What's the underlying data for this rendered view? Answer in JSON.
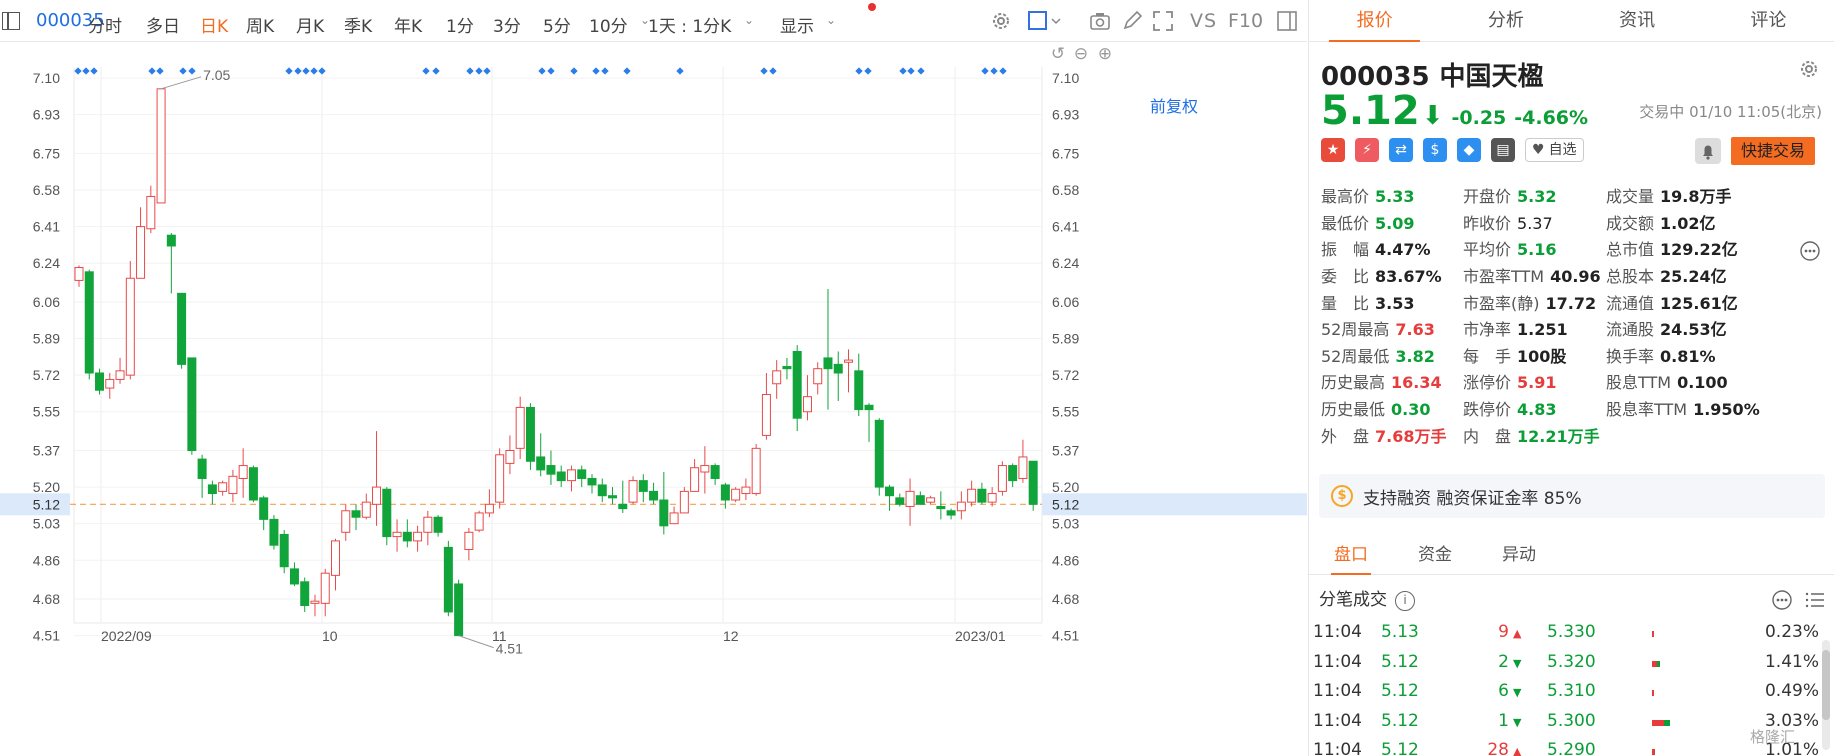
{
  "toolbar": {
    "code": "000035",
    "periods": [
      {
        "label": "分时",
        "left": 0
      },
      {
        "label": "多日"
      },
      {
        "label": "日K",
        "active": true
      },
      {
        "label": "周K"
      },
      {
        "label": "月K"
      },
      {
        "label": "季K"
      },
      {
        "label": "年K"
      },
      {
        "label": "1分"
      },
      {
        "label": "3分"
      },
      {
        "label": "5分"
      },
      {
        "label": "10分"
      },
      {
        "label": "1天 : 1分K"
      },
      {
        "label": "显示"
      }
    ],
    "vs_label": "VS",
    "f10_label": "F10",
    "fq_label": "前复权"
  },
  "chart_data": {
    "type": "candlestick",
    "y_ticks": [
      "7.10",
      "6.93",
      "6.75",
      "6.58",
      "6.41",
      "6.24",
      "6.06",
      "5.89",
      "5.72",
      "5.55",
      "5.37",
      "5.20",
      "5.03",
      "4.86",
      "4.68",
      "4.51"
    ],
    "x_labels": [
      "2022/09",
      "10",
      "11",
      "12",
      "2023/01"
    ],
    "ylim": [
      4.42,
      7.17
    ],
    "current_price": "5.12",
    "max_label": "7.05",
    "min_label": "4.51",
    "candles": [
      [
        6.16,
        6.22,
        6.13,
        6.23
      ],
      [
        6.2,
        5.73,
        5.7,
        6.21
      ],
      [
        5.73,
        5.65,
        5.63,
        5.75
      ],
      [
        5.66,
        5.7,
        5.61,
        5.73
      ],
      [
        5.7,
        5.74,
        5.68,
        5.8
      ],
      [
        5.72,
        6.17,
        5.7,
        6.25
      ],
      [
        6.17,
        6.41,
        6.28,
        6.5
      ],
      [
        6.4,
        6.55,
        6.38,
        6.6
      ],
      [
        6.52,
        7.05,
        6.52,
        7.05
      ],
      [
        6.37,
        6.32,
        6.1,
        6.38
      ],
      [
        6.1,
        5.77,
        5.75,
        6.1
      ],
      [
        5.8,
        5.37,
        5.35,
        5.8
      ],
      [
        5.33,
        5.24,
        5.15,
        5.35
      ],
      [
        5.21,
        5.17,
        5.12,
        5.23
      ],
      [
        5.18,
        5.22,
        5.16,
        5.23
      ],
      [
        5.17,
        5.25,
        5.13,
        5.28
      ],
      [
        5.24,
        5.3,
        5.15,
        5.38
      ],
      [
        5.29,
        5.14,
        5.13,
        5.3
      ],
      [
        5.15,
        5.05,
        5.0,
        5.16
      ],
      [
        5.05,
        4.93,
        4.91,
        5.07
      ],
      [
        4.98,
        4.83,
        4.8,
        5.0
      ],
      [
        4.82,
        4.75,
        4.74,
        4.85
      ],
      [
        4.76,
        4.65,
        4.62,
        4.78
      ],
      [
        4.66,
        4.67,
        4.6,
        4.7
      ],
      [
        4.66,
        4.8,
        4.6,
        4.82
      ],
      [
        4.79,
        4.95,
        4.72,
        4.96
      ],
      [
        4.99,
        5.09,
        4.95,
        5.12
      ],
      [
        5.09,
        5.06,
        5.0,
        5.12
      ],
      [
        5.06,
        5.13,
        5.05,
        5.17
      ],
      [
        5.12,
        5.2,
        5.02,
        5.46
      ],
      [
        5.19,
        4.97,
        4.93,
        5.2
      ],
      [
        4.97,
        4.99,
        4.9,
        5.05
      ],
      [
        4.99,
        4.95,
        4.92,
        5.05
      ],
      [
        4.95,
        4.99,
        4.9,
        5.02
      ],
      [
        4.99,
        5.06,
        4.93,
        5.09
      ],
      [
        5.06,
        4.99,
        4.97,
        5.07
      ],
      [
        4.92,
        4.62,
        4.6,
        4.95
      ],
      [
        4.75,
        4.51,
        4.51,
        4.77
      ],
      [
        4.91,
        4.99,
        4.86,
        5.01
      ],
      [
        5.0,
        5.08,
        4.99,
        5.09
      ],
      [
        5.08,
        5.12,
        5.06,
        5.19
      ],
      [
        5.13,
        5.35,
        5.1,
        5.38
      ],
      [
        5.31,
        5.37,
        5.26,
        5.44
      ],
      [
        5.38,
        5.57,
        5.33,
        5.62
      ],
      [
        5.57,
        5.32,
        5.28,
        5.59
      ],
      [
        5.34,
        5.28,
        5.25,
        5.45
      ],
      [
        5.3,
        5.26,
        5.21,
        5.37
      ],
      [
        5.27,
        5.23,
        5.2,
        5.3
      ],
      [
        5.23,
        5.28,
        5.18,
        5.3
      ],
      [
        5.28,
        5.24,
        5.2,
        5.3
      ],
      [
        5.24,
        5.21,
        5.17,
        5.26
      ],
      [
        5.21,
        5.16,
        5.13,
        5.24
      ],
      [
        5.16,
        5.15,
        5.12,
        5.2
      ],
      [
        5.12,
        5.1,
        5.08,
        5.23
      ],
      [
        5.13,
        5.23,
        5.12,
        5.25
      ],
      [
        5.23,
        5.18,
        5.13,
        5.26
      ],
      [
        5.18,
        5.14,
        5.12,
        5.22
      ],
      [
        5.14,
        5.02,
        4.98,
        5.27
      ],
      [
        5.03,
        5.08,
        5.03,
        5.11
      ],
      [
        5.08,
        5.18,
        5.08,
        5.2
      ],
      [
        5.18,
        5.29,
        5.18,
        5.33
      ],
      [
        5.27,
        5.3,
        5.17,
        5.39
      ],
      [
        5.3,
        5.24,
        5.21,
        5.31
      ],
      [
        5.21,
        5.14,
        5.1,
        5.22
      ],
      [
        5.14,
        5.19,
        5.13,
        5.2
      ],
      [
        5.17,
        5.2,
        5.14,
        5.24
      ],
      [
        5.17,
        5.38,
        5.16,
        5.4
      ],
      [
        5.44,
        5.63,
        5.42,
        5.73
      ],
      [
        5.68,
        5.74,
        5.61,
        5.79
      ],
      [
        5.76,
        5.75,
        5.7,
        5.8
      ],
      [
        5.83,
        5.52,
        5.46,
        5.86
      ],
      [
        5.55,
        5.62,
        5.51,
        5.72
      ],
      [
        5.68,
        5.75,
        5.63,
        5.78
      ],
      [
        5.8,
        5.75,
        5.56,
        6.12
      ],
      [
        5.77,
        5.73,
        5.6,
        5.83
      ],
      [
        5.78,
        5.79,
        5.64,
        5.84
      ],
      [
        5.74,
        5.56,
        5.53,
        5.82
      ],
      [
        5.58,
        5.56,
        5.41,
        5.59
      ],
      [
        5.51,
        5.2,
        5.16,
        5.52
      ],
      [
        5.2,
        5.16,
        5.09,
        5.21
      ],
      [
        5.15,
        5.12,
        5.11,
        5.17
      ],
      [
        5.11,
        5.18,
        5.02,
        5.24
      ],
      [
        5.16,
        5.12,
        5.12,
        5.18
      ],
      [
        5.13,
        5.15,
        5.12,
        5.16
      ],
      [
        5.11,
        5.1,
        5.05,
        5.18
      ],
      [
        5.09,
        5.07,
        5.05,
        5.1
      ],
      [
        5.09,
        5.13,
        5.05,
        5.18
      ],
      [
        5.13,
        5.19,
        5.11,
        5.23
      ],
      [
        5.19,
        5.13,
        5.12,
        5.22
      ],
      [
        5.13,
        5.17,
        5.11,
        5.2
      ],
      [
        5.18,
        5.3,
        5.16,
        5.32
      ],
      [
        5.3,
        5.23,
        5.2,
        5.31
      ],
      [
        5.24,
        5.34,
        5.22,
        5.42
      ],
      [
        5.32,
        5.12,
        5.09,
        5.32
      ]
    ],
    "markers": [
      78,
      86,
      94,
      152,
      160,
      183,
      192,
      289,
      298,
      306,
      314,
      322,
      426,
      436,
      470,
      479,
      487,
      542,
      551,
      574,
      596,
      605,
      627,
      680,
      764,
      773,
      859,
      868,
      903,
      911,
      921,
      985,
      994,
      1003
    ]
  },
  "panel": {
    "tabs": [
      "报价",
      "分析",
      "资讯",
      "评论"
    ],
    "code": "000035",
    "name": "中国天楹",
    "price": "5.12",
    "arrow": "⬇",
    "change": "-0.25",
    "pct": "-4.66%",
    "status": "交易中 01/10 11:05(北京)",
    "badges": [
      {
        "icon": "china-flag-icon",
        "glyph": "★",
        "color": "#e84b3a"
      },
      {
        "icon": "lightning-icon",
        "glyph": "⚡",
        "color": "#ee5b60"
      },
      {
        "icon": "shuffle-icon",
        "glyph": "⇄",
        "color": "#2d8ff0"
      },
      {
        "icon": "dollar-icon",
        "glyph": "$",
        "color": "#2d8ff0"
      },
      {
        "icon": "tag-icon",
        "glyph": "◆",
        "color": "#2d8ff0"
      },
      {
        "icon": "book-icon",
        "glyph": "▤",
        "color": "#555"
      }
    ],
    "watch_label": "自选",
    "trade_label": "快捷交易",
    "stats": [
      [
        {
          "l": "最高价",
          "v": "5.33",
          "c": "c-down"
        },
        {
          "l": "开盘价",
          "v": "5.32",
          "c": "c-down"
        },
        {
          "l": "成交量",
          "v": "19.8万手",
          "c": "c-plain"
        }
      ],
      [
        {
          "l": "最低价",
          "v": "5.09",
          "c": "c-down"
        },
        {
          "l": "昨收价",
          "v": "5.37",
          "c": "c-plain-n"
        },
        {
          "l": "成交额",
          "v": "1.02亿",
          "c": "c-plain"
        }
      ],
      [
        {
          "l": "振　幅",
          "v": "4.47%",
          "c": "c-plain"
        },
        {
          "l": "平均价",
          "v": "5.16",
          "c": "c-down"
        },
        {
          "l": "总市值",
          "v": "129.22亿",
          "c": "c-plain"
        }
      ],
      [
        {
          "l": "委　比",
          "v": "83.67%",
          "c": "c-plain"
        },
        {
          "l": "市盈率TTM",
          "v": "40.96",
          "c": "c-plain"
        },
        {
          "l": "总股本",
          "v": "25.24亿",
          "c": "c-plain"
        }
      ],
      [
        {
          "l": "量　比",
          "v": "3.53",
          "c": "c-plain"
        },
        {
          "l": "市盈率(静)",
          "v": "17.72",
          "c": "c-plain"
        },
        {
          "l": "流通值",
          "v": "125.61亿",
          "c": "c-plain"
        }
      ],
      [
        {
          "l": "52周最高",
          "v": "7.63",
          "c": "c-up"
        },
        {
          "l": "市净率",
          "v": "1.251",
          "c": "c-plain"
        },
        {
          "l": "流通股",
          "v": "24.53亿",
          "c": "c-plain"
        }
      ],
      [
        {
          "l": "52周最低",
          "v": "3.82",
          "c": "c-down"
        },
        {
          "l": "每　手",
          "v": "100股",
          "c": "c-plain"
        },
        {
          "l": "换手率",
          "v": "0.81%",
          "c": "c-plain"
        }
      ],
      [
        {
          "l": "历史最高",
          "v": "16.34",
          "c": "c-up"
        },
        {
          "l": "涨停价",
          "v": "5.91",
          "c": "c-up"
        },
        {
          "l": "股息TTM",
          "v": "0.100",
          "c": "c-plain"
        }
      ],
      [
        {
          "l": "历史最低",
          "v": "0.30",
          "c": "c-down"
        },
        {
          "l": "跌停价",
          "v": "4.83",
          "c": "c-down"
        },
        {
          "l": "股息率TTM",
          "v": "1.950%",
          "c": "c-plain"
        }
      ],
      [
        {
          "l": "外　盘",
          "v": "7.68万手",
          "c": "c-up"
        },
        {
          "l": "内　盘",
          "v": "12.21万手",
          "c": "c-down"
        },
        null
      ]
    ],
    "margin_icon": "$",
    "margin_text": "支持融资 融资保证金率 85%",
    "sub_tabs": [
      "盘口",
      "资金",
      "异动"
    ],
    "ticks_title": "分笔成交",
    "ticks": [
      {
        "time": "11:04",
        "price": "5.13",
        "vol": "9",
        "dir": "up",
        "ref": "5.330",
        "bar": [
          2,
          0
        ],
        "pct": "0.23%"
      },
      {
        "time": "11:04",
        "price": "5.12",
        "vol": "2",
        "dir": "down",
        "ref": "5.320",
        "bar": [
          5,
          3
        ],
        "pct": "1.41%"
      },
      {
        "time": "11:04",
        "price": "5.12",
        "vol": "6",
        "dir": "down",
        "ref": "5.310",
        "bar": [
          2,
          0
        ],
        "pct": "0.49%"
      },
      {
        "time": "11:04",
        "price": "5.12",
        "vol": "1",
        "dir": "down",
        "ref": "5.300",
        "bar": [
          12,
          6
        ],
        "pct": "3.03%"
      },
      {
        "time": "11:04",
        "price": "5.12",
        "vol": "28",
        "dir": "up",
        "ref": "5.290",
        "bar": [
          3,
          0
        ],
        "pct": "1.01%"
      }
    ],
    "watermark": "格隆汇"
  }
}
